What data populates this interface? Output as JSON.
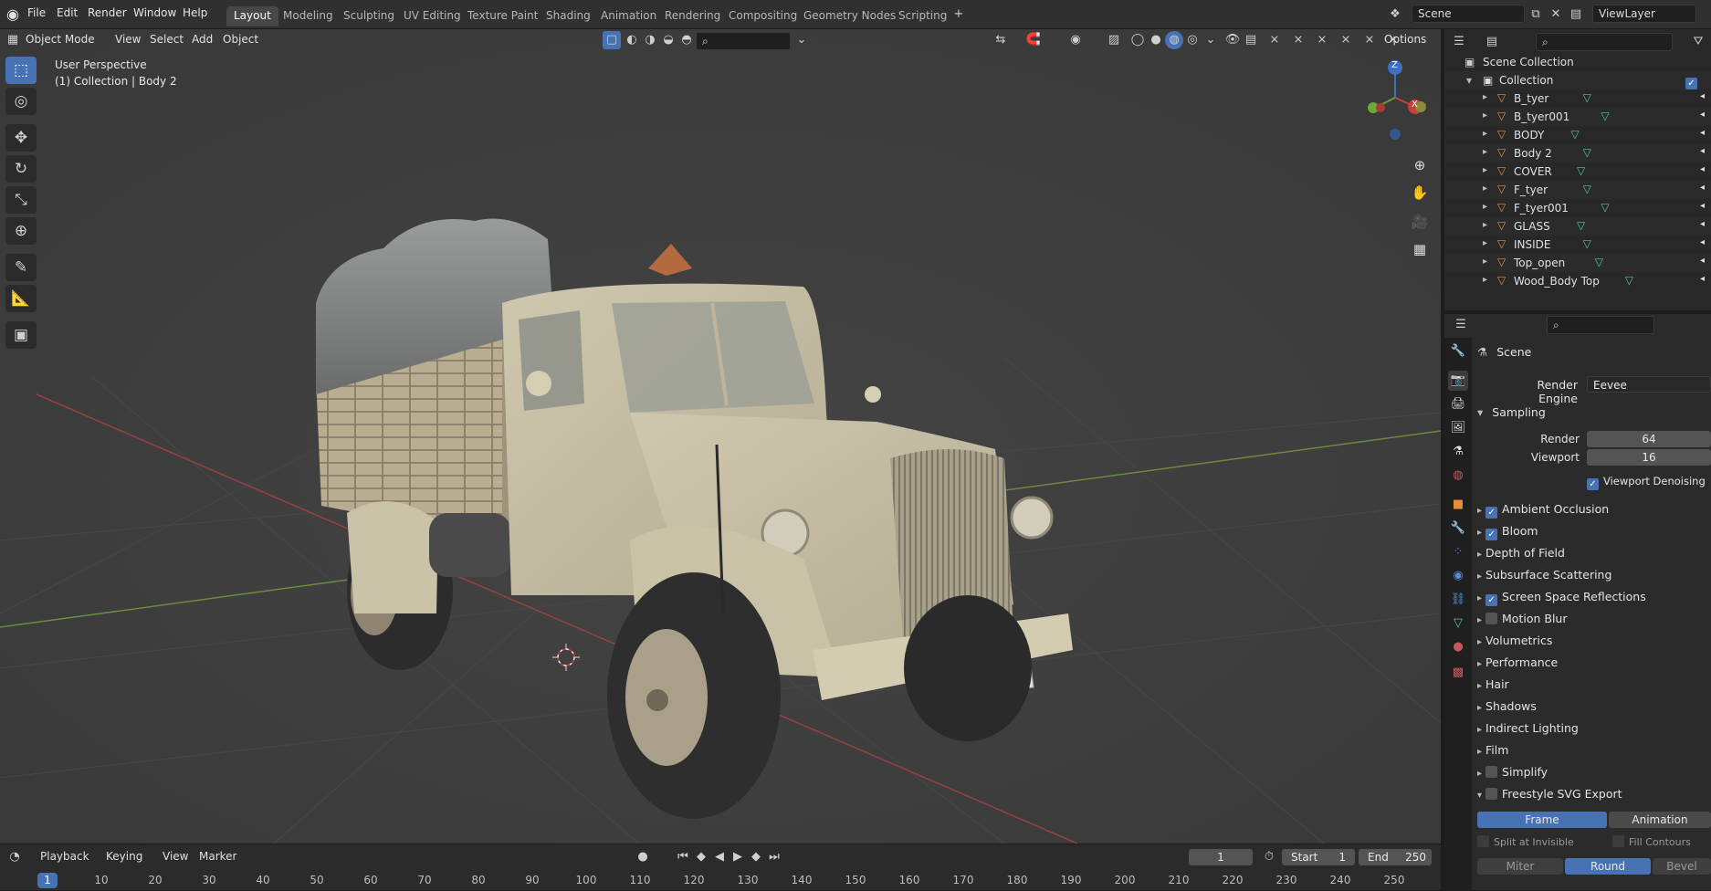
{
  "topbar": {
    "menus": [
      "File",
      "Edit",
      "Render",
      "Window",
      "Help"
    ],
    "workspaces": [
      "Layout",
      "Modeling",
      "Sculpting",
      "UV Editing",
      "Texture Paint",
      "Shading",
      "Animation",
      "Rendering",
      "Compositing",
      "Geometry Nodes",
      "Scripting"
    ],
    "active_workspace": "Layout",
    "scene": "Scene",
    "view_layer": "ViewLayer"
  },
  "viewport": {
    "mode": "Object Mode",
    "menus": [
      "View",
      "Select",
      "Add",
      "Object"
    ],
    "info_line1": "User Perspective",
    "info_line2": "(1) Collection | Body 2",
    "options": "Options",
    "gizmo_z": "Z",
    "gizmo_x": "X"
  },
  "outliner": {
    "scene_collection": "Scene Collection",
    "collection": "Collection",
    "objects": [
      "B_tyer",
      "B_tyer001",
      "BODY",
      "Body 2",
      "COVER",
      "F_tyer",
      "F_tyer001",
      "GLASS",
      "INSIDE",
      "Top_open",
      "Wood_Body Top"
    ]
  },
  "properties": {
    "context": "Scene",
    "render_engine_label": "Render Engine",
    "render_engine": "Eevee",
    "sampling": "Sampling",
    "render_label": "Render",
    "render_value": "64",
    "viewport_label": "Viewport",
    "viewport_value": "16",
    "viewport_denoising": "Viewport Denoising",
    "panels": {
      "ambient_occlusion": "Ambient Occlusion",
      "bloom": "Bloom",
      "depth_of_field": "Depth of Field",
      "subsurface_scattering": "Subsurface Scattering",
      "screen_space_reflections": "Screen Space Reflections",
      "motion_blur": "Motion Blur",
      "volumetrics": "Volumetrics",
      "performance": "Performance",
      "hair": "Hair",
      "shadows": "Shadows",
      "indirect_lighting": "Indirect Lighting",
      "film": "Film",
      "simplify": "Simplify",
      "freestyle_svg_export": "Freestyle SVG Export"
    },
    "frame_tab": "Frame",
    "animation_tab": "Animation",
    "split_at_invisible": "Split at Invisible",
    "fill_contours": "Fill Contours",
    "miter": "Miter",
    "round": "Round",
    "bevel": "Bevel"
  },
  "timeline": {
    "menus": [
      "Playback",
      "Keying",
      "View",
      "Marker"
    ],
    "current_frame": "1",
    "start_label": "Start",
    "start": "1",
    "end_label": "End",
    "end": "250",
    "ticks": [
      "1",
      "10",
      "20",
      "30",
      "40",
      "50",
      "60",
      "70",
      "80",
      "90",
      "100",
      "110",
      "120",
      "130",
      "140",
      "150",
      "160",
      "170",
      "180",
      "190",
      "200",
      "210",
      "220",
      "230",
      "240",
      "250"
    ]
  },
  "colors": {
    "accent": "#4772b3",
    "mesh_icon": "#e58f3b",
    "data_icon": "#4ec9a8"
  }
}
